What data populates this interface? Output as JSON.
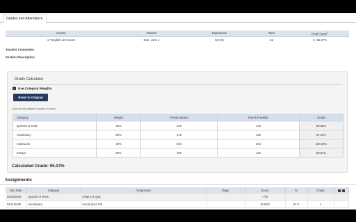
{
  "tabs": [
    {
      "label": "Grades and Attendance"
    }
  ],
  "course": {
    "headers": [
      "Course",
      "Teacher",
      "Expression",
      "Term",
      "Final Grade"
    ],
    "final_grade_sup": "1",
    "row": {
      "course": "1 *English 10 Honors",
      "teacher": "Doe, John J",
      "expression": "5(A-E)",
      "term": "S2",
      "final_letter": "A",
      "final_pct": "95.07%"
    }
  },
  "meta": {
    "teacher_comments": "Teacher Comments:",
    "section_description": "Section Description:"
  },
  "calculator": {
    "title": "Grade Calculator",
    "checkbox_label": "Use Category Weights",
    "checkbox_checked": true,
    "reset_label": "Reset to Original",
    "hint": "Click on any weight or points to edit it.",
    "headers": [
      "Category",
      "Weight",
      "Points Earned",
      "Points Possible",
      "Grade"
    ],
    "rows": [
      {
        "category": "Quizzes & Tests",
        "weight": "15%",
        "earned": "120",
        "possible": "134",
        "grade": "89.55%"
      },
      {
        "category": "Vocabulary",
        "weight": "20%",
        "earned": "175",
        "possible": "180",
        "grade": "97.22%"
      },
      {
        "category": "Classwork",
        "weight": "20%",
        "earned": "204",
        "possible": "204",
        "grade": "100.00%"
      },
      {
        "category": "Essays",
        "weight": "20%",
        "earned": "100",
        "possible": "110",
        "grade": "90.91%"
      }
    ],
    "calculated_grade": "Calculated Grade: 95.07%"
  },
  "assignments": {
    "title": "Assignments",
    "headers": [
      "Due Date",
      "Category",
      "Assignment",
      "Flags",
      "Score",
      "%",
      "Grade"
    ],
    "rows": [
      {
        "due": "04/15/2025",
        "category": "Quizzes & Tests",
        "assignment": "Chap 3-4 Quiz",
        "score": "--/10",
        "pct": "",
        "grade": ""
      },
      {
        "due": "04/11/2025",
        "category": "Vocabulary",
        "assignment": "Vocab Quiz #18",
        "score": "19.5/20",
        "pct": "97.5",
        "grade": "A"
      }
    ]
  }
}
